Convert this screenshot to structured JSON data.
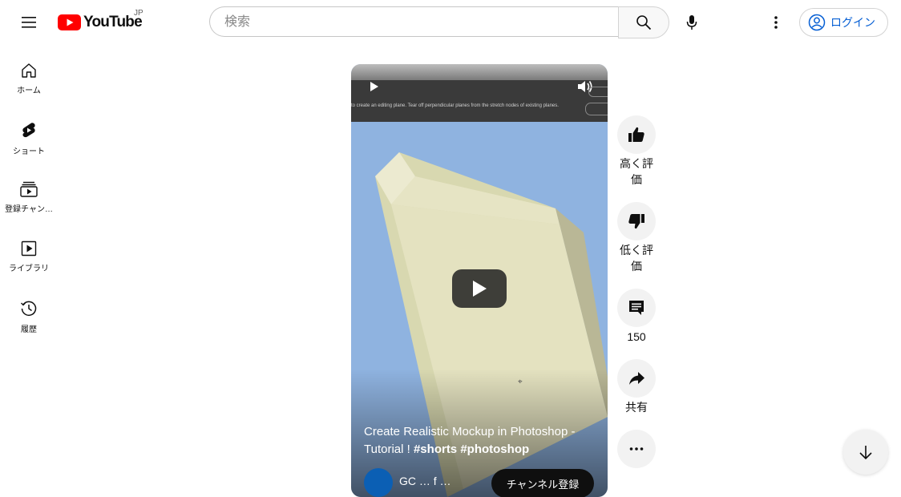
{
  "header": {
    "logo_text": "YouTube",
    "country_code": "JP",
    "search_placeholder": "検索",
    "login_label": "ログイン"
  },
  "sidebar": {
    "items": [
      {
        "label": "ホーム",
        "icon": "home-icon"
      },
      {
        "label": "ショート",
        "icon": "shorts-icon"
      },
      {
        "label": "登録チャン…",
        "icon": "subscriptions-icon"
      },
      {
        "label": "ライブラリ",
        "icon": "library-icon"
      },
      {
        "label": "履歴",
        "icon": "history-icon"
      }
    ]
  },
  "video": {
    "title_plain": "Create Realistic Mockup in Photoshop - Tutorial ! ",
    "hashtags": "#shorts #photoshop",
    "caption_strip": "to create an editing plane. Tear off perpendicular planes from the stretch nodes of existing planes.",
    "channel_name": "GC … f …",
    "subscribe_label": "チャンネル登録"
  },
  "actions": {
    "like_label": "高く評価",
    "dislike_label": "低く評価",
    "comments_count": "150",
    "share_label": "共有"
  },
  "colors": {
    "brand_red": "#ff0000",
    "link_blue": "#065fd4",
    "sky": "#8fb3e0"
  }
}
